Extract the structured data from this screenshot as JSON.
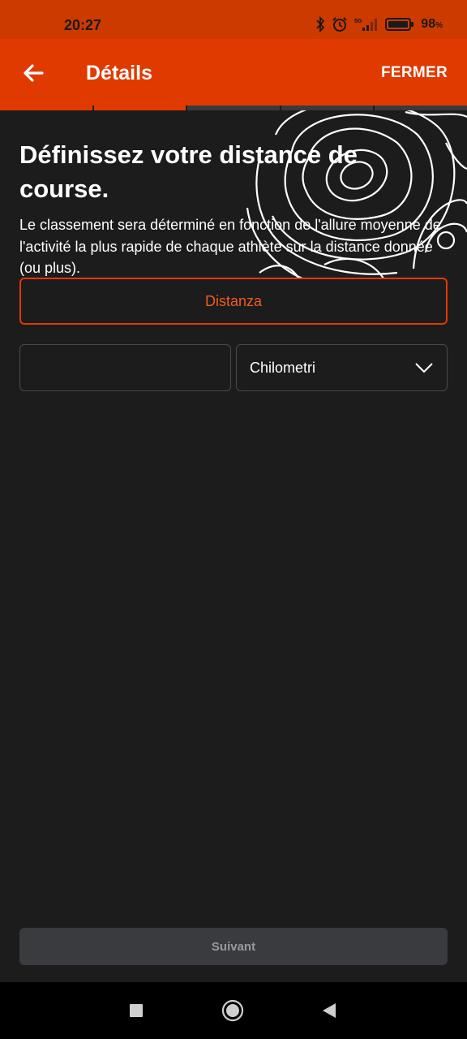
{
  "status_bar": {
    "time": "20:27",
    "network": "5G",
    "battery": "98",
    "battery_unit": "%",
    "icons": [
      "bluetooth-icon",
      "alarm-icon",
      "signal-icon",
      "battery-icon"
    ]
  },
  "app_bar": {
    "back_icon": "arrow-left-icon",
    "title": "Détails",
    "close_label": "FERMER"
  },
  "progress": {
    "total_steps": 5,
    "completed_steps": 2
  },
  "content": {
    "heading": "Définissez votre distance de course.",
    "description": "Le classement sera déterminé en fonction de l'allure moyenne de l'activité la plus rapide de chaque athlète sur la distance donnée (ou plus).",
    "distance_button": "Distanza",
    "distance_value": "",
    "distance_placeholder": "",
    "unit_selected": "Chilometri",
    "next_button": "Suivant"
  },
  "colors": {
    "brand": "#e13a00",
    "background": "#1c1c1d",
    "disabled_button": "#3a3b3e"
  },
  "nav_bar": {
    "icons": [
      "recents-square-icon",
      "home-circle-icon",
      "back-triangle-icon"
    ]
  }
}
